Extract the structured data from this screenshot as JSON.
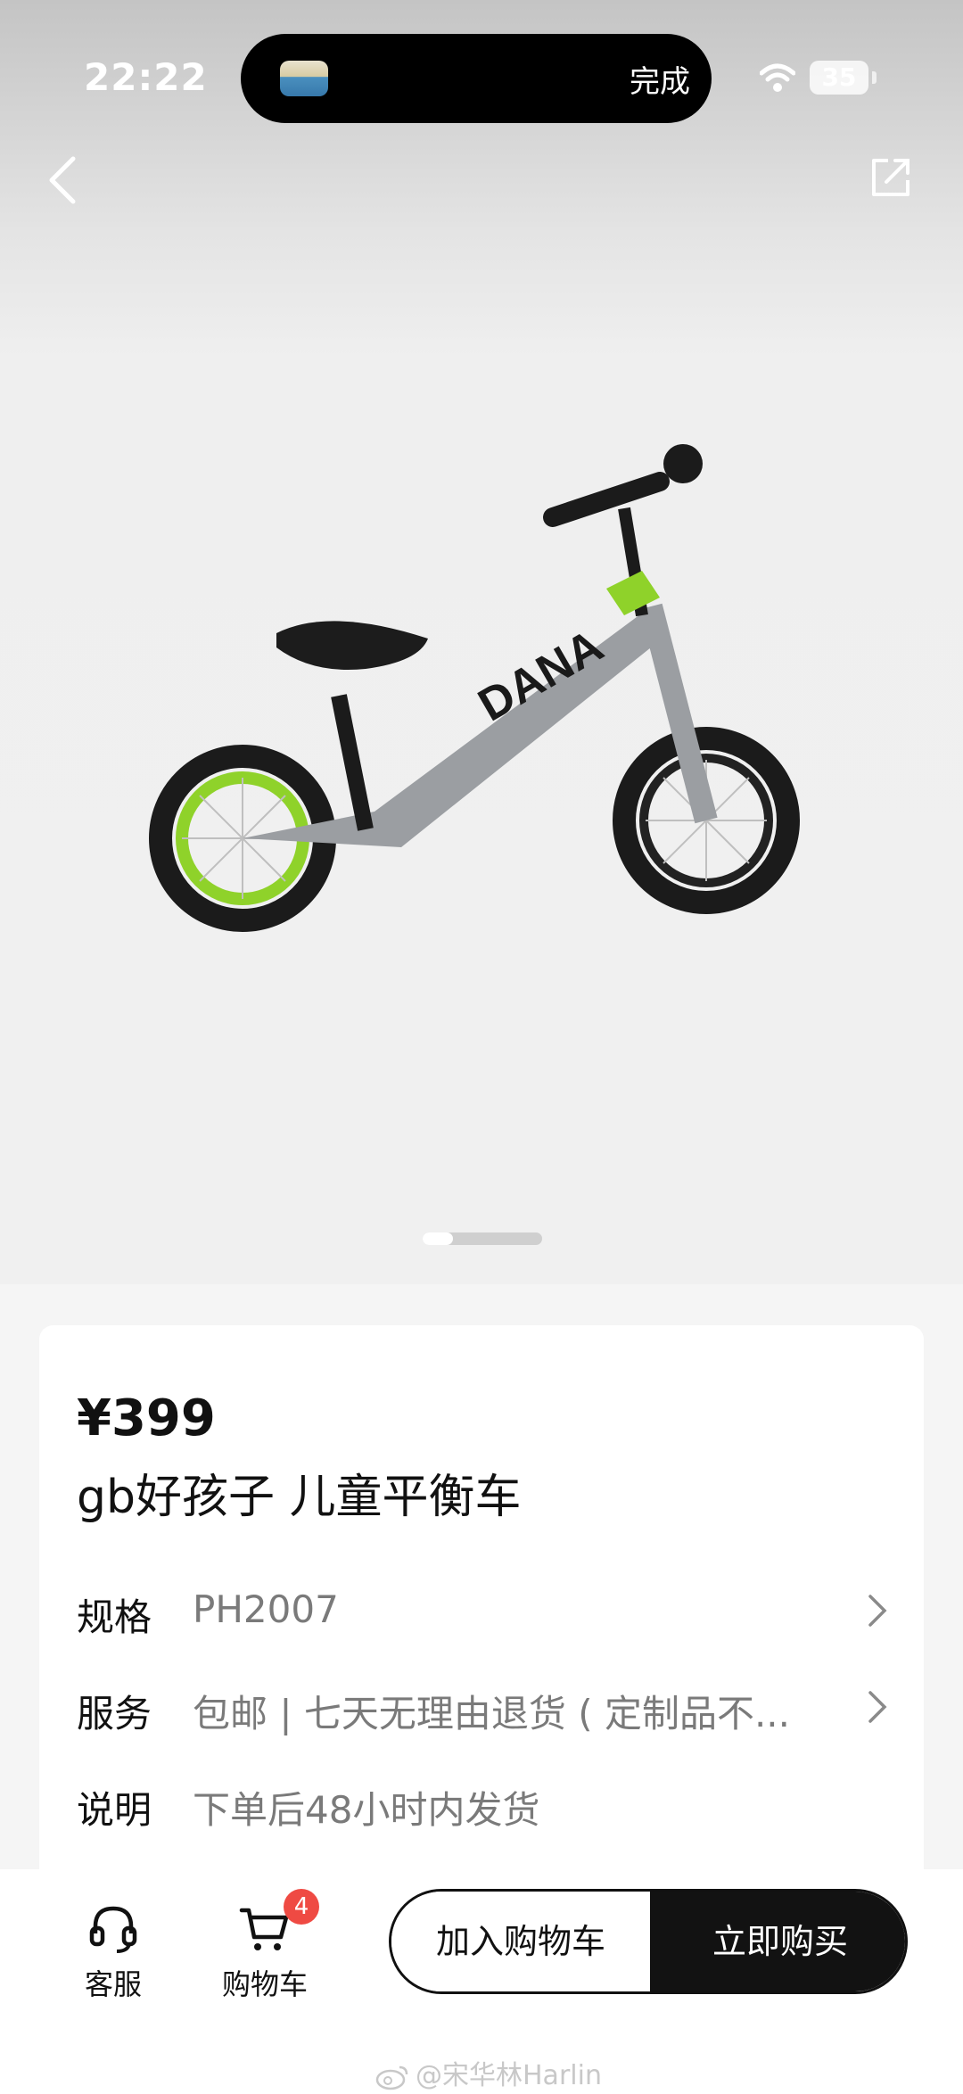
{
  "status_bar": {
    "time": "22:22",
    "live_activity_action": "完成",
    "battery": "35"
  },
  "navigation": {
    "back_icon": "chevron-left-icon",
    "share_icon": "share-icon"
  },
  "gallery": {
    "image_description": "grey kids balance bike with green rims",
    "bike_brand_text": "DANA",
    "current_page": 1
  },
  "product": {
    "price": "¥399",
    "title": "gb好孩子 儿童平衡车",
    "rows": [
      {
        "label": "规格",
        "value": "PH2007",
        "has_chevron": true
      },
      {
        "label": "服务",
        "value": "包邮 | 七天无理由退货 ( 定制品不...",
        "has_chevron": true
      },
      {
        "label": "说明",
        "value": "下单后48小时内发货",
        "has_chevron": false
      }
    ]
  },
  "bottom_bar": {
    "customer_service_label": "客服",
    "cart_label": "购物车",
    "cart_count": "4",
    "add_to_cart_label": "加入购物车",
    "buy_now_label": "立即购买"
  },
  "watermark": "@宋华林Harlin",
  "colors": {
    "badge": "#ef4a43",
    "buy_now_bg": "#121212",
    "rim_green": "#8fd22a",
    "frame_grey": "#9b9ea2"
  }
}
